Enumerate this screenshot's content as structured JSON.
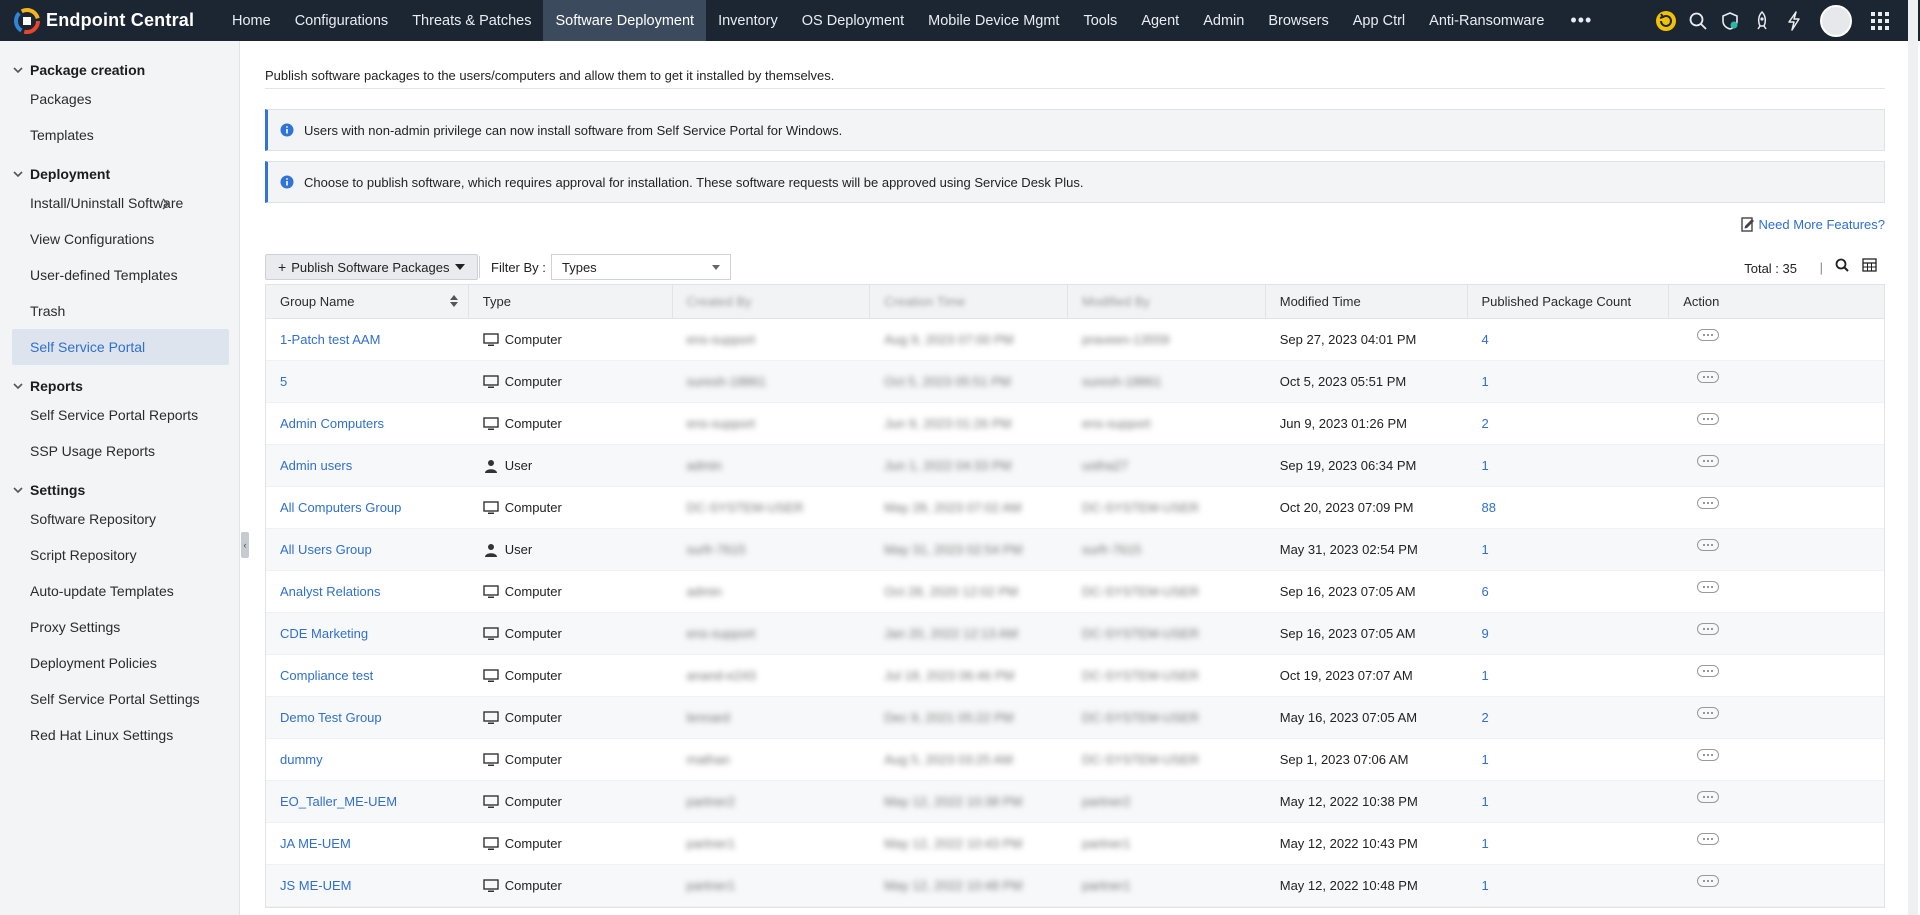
{
  "app": {
    "title": "Endpoint Central"
  },
  "nav": {
    "items": [
      "Home",
      "Configurations",
      "Threats & Patches",
      "Software Deployment",
      "Inventory",
      "OS Deployment",
      "Mobile Device Mgmt",
      "Tools",
      "Agent",
      "Admin",
      "Browsers",
      "App Ctrl",
      "Anti-Ransomware"
    ],
    "active": "Software Deployment",
    "more": "•••"
  },
  "sidebar": {
    "sections": [
      {
        "title": "Package creation",
        "items": [
          "Packages",
          "Templates"
        ]
      },
      {
        "title": "Deployment",
        "items": [
          "Install/Uninstall Software",
          "View Configurations",
          "User-defined Templates",
          "Trash",
          "Self Service Portal"
        ]
      },
      {
        "title": "Reports",
        "items": [
          "Self Service Portal Reports",
          "SSP Usage Reports"
        ]
      },
      {
        "title": "Settings",
        "items": [
          "Software Repository",
          "Script Repository",
          "Auto-update Templates",
          "Proxy Settings",
          "Deployment Policies",
          "Self Service Portal Settings",
          "Red Hat Linux Settings"
        ]
      }
    ],
    "active_item": "Self Service Portal"
  },
  "main": {
    "intro": "Publish software packages to the users/computers and allow them to get it installed by themselves.",
    "info1": "Users with non-admin privilege can now install software from Self Service Portal for Windows.",
    "info2": "Choose to publish software, which requires approval for installation. These software requests will be approved using Service Desk Plus.",
    "need_more": "Need More Features?",
    "publish_button": "Publish Software Packages",
    "filter_label": "Filter By :",
    "filter_value": "Types",
    "total": "Total : 35"
  },
  "table": {
    "columns": [
      "Group Name",
      "Type",
      "Created By",
      "Creation Time",
      "Modified By",
      "Modified Time",
      "Published Package Count",
      "Action"
    ],
    "rows": [
      {
        "name": "1-Patch test AAM",
        "type": "Computer",
        "created_by": "ens-support",
        "creation_time": "Aug 9, 2023 07:00 PM",
        "modified_by": "praveen-13559",
        "modified": "Sep 27, 2023 04:01 PM",
        "count": "4"
      },
      {
        "name": "5",
        "type": "Computer",
        "created_by": "suresh-18861",
        "creation_time": "Oct 5, 2023 05:51 PM",
        "modified_by": "suresh-18861",
        "modified": "Oct 5, 2023 05:51 PM",
        "count": "1"
      },
      {
        "name": "Admin Computers",
        "type": "Computer",
        "created_by": "ens-support",
        "creation_time": "Jun 9, 2023 01:26 PM",
        "modified_by": "ens-support",
        "modified": "Jun 9, 2023 01:26 PM",
        "count": "2"
      },
      {
        "name": "Admin users",
        "type": "User",
        "created_by": "admin",
        "creation_time": "Jun 1, 2022 04:33 PM",
        "modified_by": "ustha27",
        "modified": "Sep 19, 2023 06:34 PM",
        "count": "1"
      },
      {
        "name": "All Computers Group",
        "type": "Computer",
        "created_by": "DC-SYSTEM-USER",
        "creation_time": "May 28, 2023 07:02 AM",
        "modified_by": "DC-SYSTEM-USER",
        "modified": "Oct 20, 2023 07:09 PM",
        "count": "88"
      },
      {
        "name": "All Users Group",
        "type": "User",
        "created_by": "surfr-7615",
        "creation_time": "May 31, 2023 02:54 PM",
        "modified_by": "surfr-7615",
        "modified": "May 31, 2023 02:54 PM",
        "count": "1"
      },
      {
        "name": "Analyst Relations",
        "type": "Computer",
        "created_by": "admin",
        "creation_time": "Oct 28, 2020 12:02 PM",
        "modified_by": "DC-SYSTEM-USER",
        "modified": "Sep 16, 2023 07:05 AM",
        "count": "6"
      },
      {
        "name": "CDE Marketing",
        "type": "Computer",
        "created_by": "ens-support",
        "creation_time": "Jan 20, 2022 12:13 AM",
        "modified_by": "DC-SYSTEM-USER",
        "modified": "Sep 16, 2023 07:05 AM",
        "count": "9"
      },
      {
        "name": "Compliance test",
        "type": "Computer",
        "created_by": "anand-e243",
        "creation_time": "Jul 18, 2023 06:46 PM",
        "modified_by": "DC-SYSTEM-USER",
        "modified": "Oct 19, 2023 07:07 AM",
        "count": "1"
      },
      {
        "name": "Demo Test Group",
        "type": "Computer",
        "created_by": "lennard",
        "creation_time": "Dec 9, 2021 05:22 PM",
        "modified_by": "DC-SYSTEM-USER",
        "modified": "May 16, 2023 07:05 AM",
        "count": "2"
      },
      {
        "name": "dummy",
        "type": "Computer",
        "created_by": "mathan",
        "creation_time": "Aug 5, 2023 03:25 AM",
        "modified_by": "DC-SYSTEM-USER",
        "modified": "Sep 1, 2023 07:06 AM",
        "count": "1"
      },
      {
        "name": "EO_Taller_ME-UEM",
        "type": "Computer",
        "created_by": "partner2",
        "creation_time": "May 12, 2022 10:38 PM",
        "modified_by": "partner2",
        "modified": "May 12, 2022 10:38 PM",
        "count": "1"
      },
      {
        "name": "JA ME-UEM",
        "type": "Computer",
        "created_by": "partner1",
        "creation_time": "May 12, 2022 10:43 PM",
        "modified_by": "partner1",
        "modified": "May 12, 2022 10:43 PM",
        "count": "1"
      },
      {
        "name": "JS ME-UEM",
        "type": "Computer",
        "created_by": "partner1",
        "creation_time": "May 12, 2022 10:48 PM",
        "modified_by": "partner1",
        "modified": "May 12, 2022 10:48 PM",
        "count": "1"
      }
    ]
  },
  "colors": {
    "topbar": "#1c2633",
    "active_nav": "#3c4a5e",
    "link": "#2f6fd1",
    "accent": "#2f74d6"
  }
}
